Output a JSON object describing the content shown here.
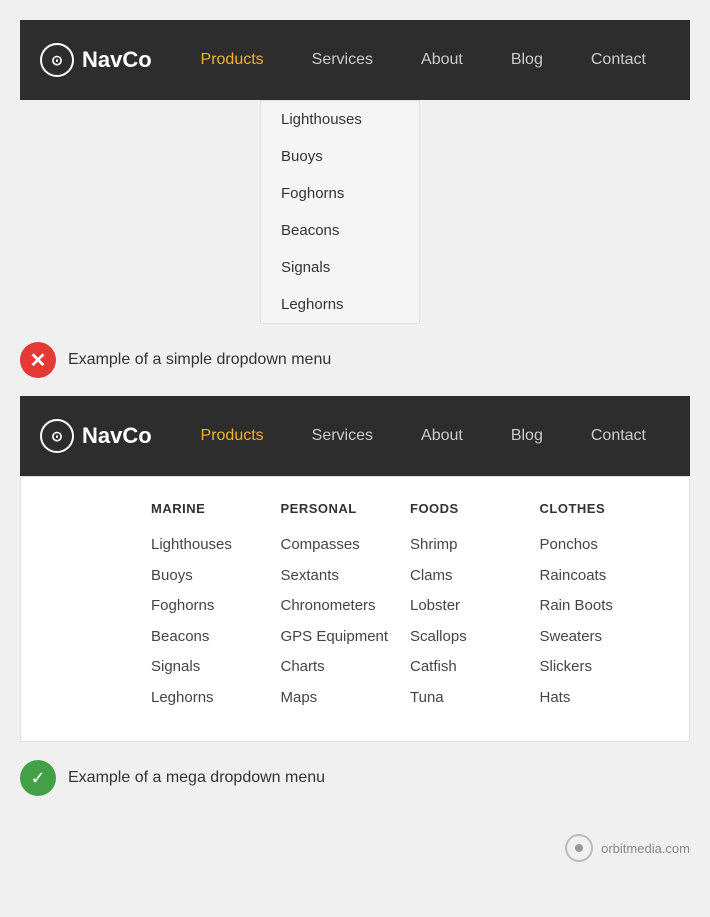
{
  "brand": {
    "icon": "©",
    "name": "NavCo"
  },
  "navbar1": {
    "links": [
      {
        "label": "Products",
        "active": true
      },
      {
        "label": "Services",
        "active": false
      },
      {
        "label": "About",
        "active": false
      },
      {
        "label": "Blog",
        "active": false
      },
      {
        "label": "Contact",
        "active": false
      }
    ]
  },
  "simple_dropdown": {
    "items": [
      "Lighthouses",
      "Buoys",
      "Foghorns",
      "Beacons",
      "Signals",
      "Leghorns"
    ]
  },
  "annotation_simple": {
    "icon": "✕",
    "text": "Example of a simple dropdown menu"
  },
  "navbar2": {
    "links": [
      {
        "label": "Products",
        "active": true
      },
      {
        "label": "Services",
        "active": false
      },
      {
        "label": "About",
        "active": false
      },
      {
        "label": "Blog",
        "active": false
      },
      {
        "label": "Contact",
        "active": false
      }
    ]
  },
  "mega_dropdown": {
    "columns": [
      {
        "header": "MARINE",
        "items": [
          "Lighthouses",
          "Buoys",
          "Foghorns",
          "Beacons",
          "Signals",
          "Leghorns"
        ]
      },
      {
        "header": "PERSONAL",
        "items": [
          "Compasses",
          "Sextants",
          "Chronometers",
          "GPS Equipment",
          "Charts",
          "Maps"
        ]
      },
      {
        "header": "FOODS",
        "items": [
          "Shrimp",
          "Clams",
          "Lobster",
          "Scallops",
          "Catfish",
          "Tuna"
        ]
      },
      {
        "header": "CLOTHES",
        "items": [
          "Ponchos",
          "Raincoats",
          "Rain Boots",
          "Sweaters",
          "Slickers",
          "Hats"
        ]
      }
    ]
  },
  "annotation_mega": {
    "icon": "✓",
    "text": "Example of a mega dropdown menu"
  },
  "footer": {
    "text": "orbitmedia.com"
  }
}
